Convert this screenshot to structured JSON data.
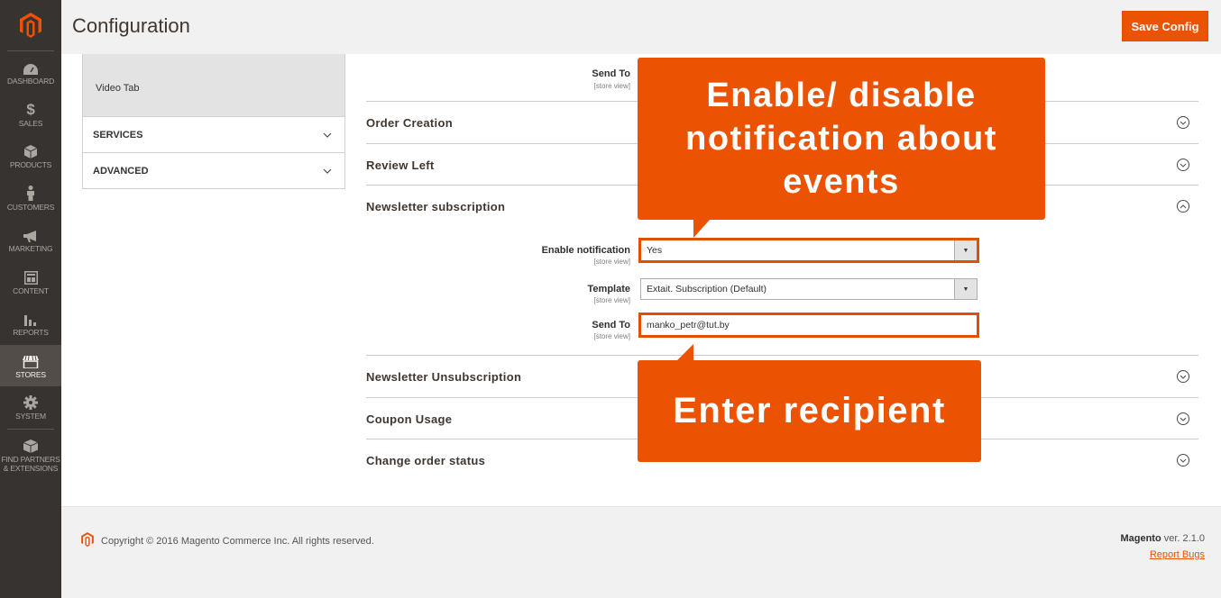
{
  "nav": {
    "items": [
      {
        "label": "DASHBOARD",
        "icon": "dashboard-icon"
      },
      {
        "label": "SALES",
        "icon": "dollar-icon"
      },
      {
        "label": "PRODUCTS",
        "icon": "cube-icon"
      },
      {
        "label": "CUSTOMERS",
        "icon": "person-icon"
      },
      {
        "label": "MARKETING",
        "icon": "megaphone-icon"
      },
      {
        "label": "CONTENT",
        "icon": "layout-icon"
      },
      {
        "label": "REPORTS",
        "icon": "bar-chart-icon"
      },
      {
        "label": "STORES",
        "icon": "store-icon"
      },
      {
        "label": "SYSTEM",
        "icon": "gear-icon"
      },
      {
        "label1": "FIND PARTNERS",
        "label2": "& EXTENSIONS",
        "icon": "box-icon"
      }
    ]
  },
  "header": {
    "title": "Configuration",
    "save_label": "Save Config"
  },
  "tabs": {
    "video": "Video Tab",
    "services": "SERVICES",
    "advanced": "ADVANCED"
  },
  "sendto_top": {
    "label": "Send To",
    "scope": "[store view]"
  },
  "sections": {
    "order_creation": "Order Creation",
    "review_left": "Review Left",
    "newsletter_sub": "Newsletter subscription",
    "newsletter_unsub": "Newsletter Unsubscription",
    "coupon_usage": "Coupon Usage",
    "change_order_status": "Change order status"
  },
  "fields": {
    "enable": {
      "label": "Enable notification",
      "scope": "[store view]",
      "value": "Yes"
    },
    "template": {
      "label": "Template",
      "scope": "[store view]",
      "value": "Extait. Subscription (Default)"
    },
    "sendto": {
      "label": "Send To",
      "scope": "[store view]",
      "value": "manko_petr@tut.by"
    }
  },
  "callouts": {
    "line1": "Enable/ disable",
    "line2": "notification about",
    "line3": "events",
    "recipient": "Enter recipient"
  },
  "footer": {
    "copyright": "Copyright © 2016 Magento Commerce Inc. All rights reserved.",
    "brand": "Magento",
    "version": " ver. 2.1.0",
    "report": "Report Bugs"
  },
  "colors": {
    "accent": "#eb5202",
    "nav_bg": "#373330"
  }
}
